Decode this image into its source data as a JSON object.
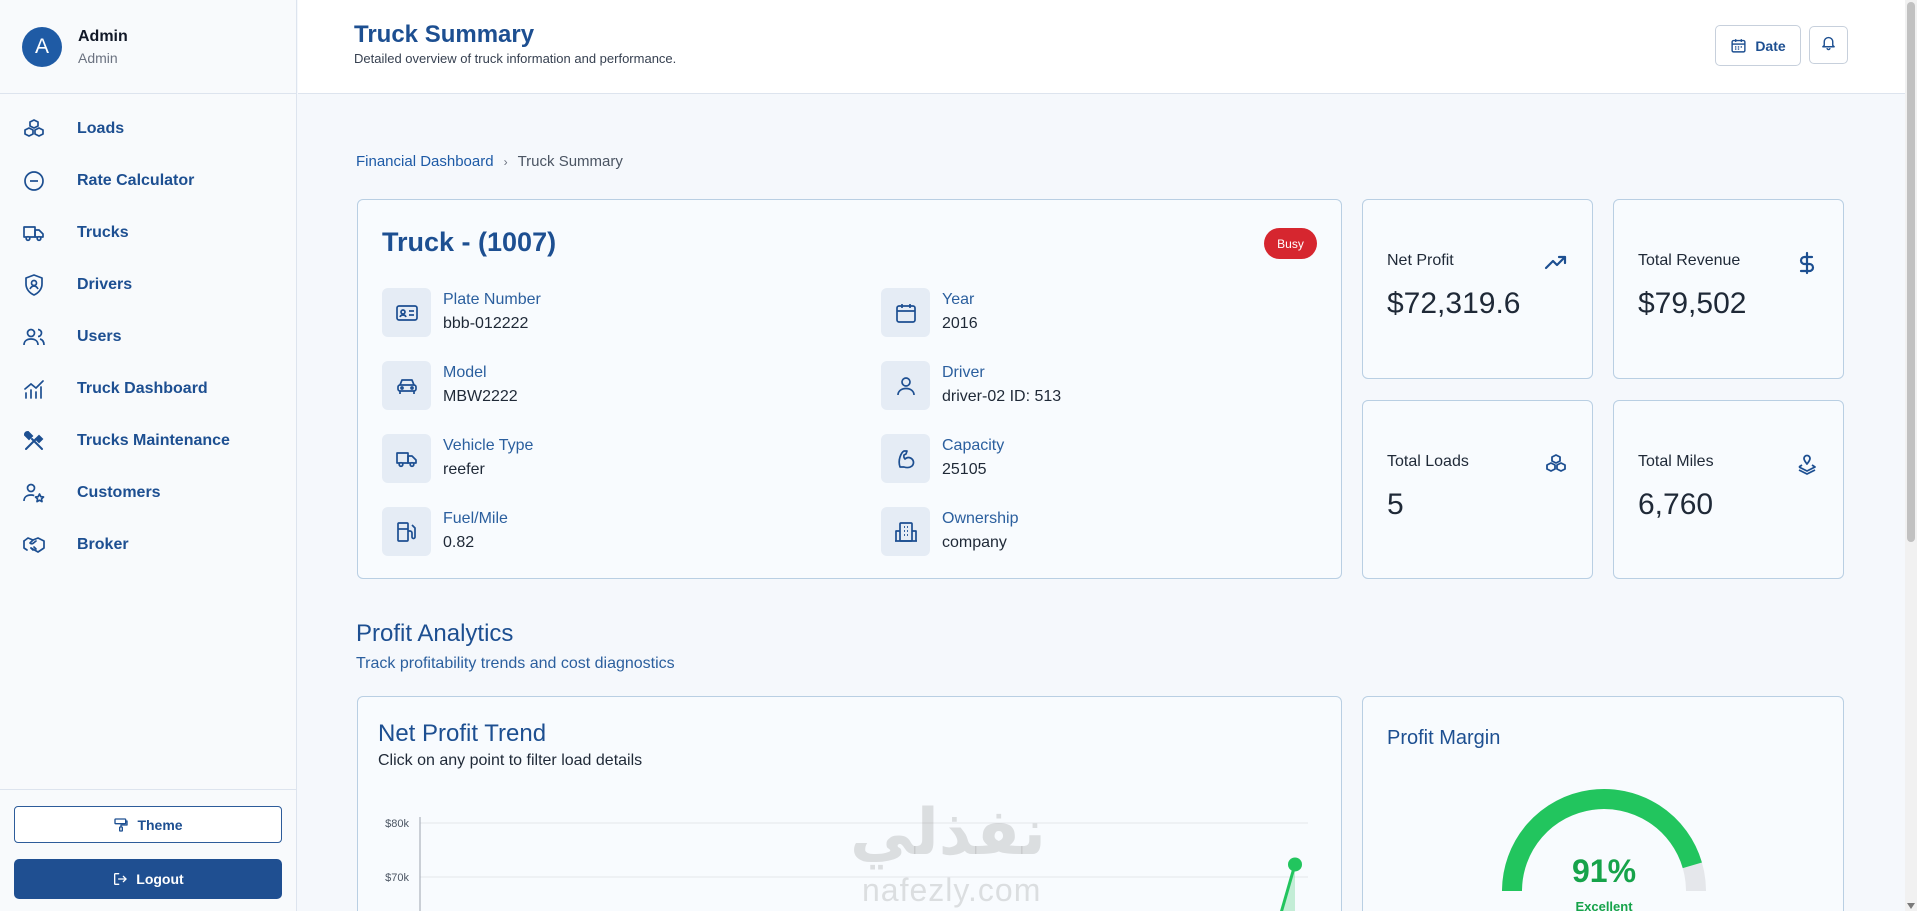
{
  "profile": {
    "initial": "A",
    "name": "Admin",
    "role": "Admin"
  },
  "sidebar": {
    "items": [
      {
        "label": "Loads",
        "icon": "boxes-icon"
      },
      {
        "label": "Rate Calculator",
        "icon": "minus-circle-icon"
      },
      {
        "label": "Trucks",
        "icon": "truck-icon"
      },
      {
        "label": "Drivers",
        "icon": "shield-user-icon"
      },
      {
        "label": "Users",
        "icon": "users-icon"
      },
      {
        "label": "Truck Dashboard",
        "icon": "chart-line-icon"
      },
      {
        "label": "Trucks Maintenance",
        "icon": "wrench-hammer-icon"
      },
      {
        "label": "Customers",
        "icon": "user-star-icon"
      },
      {
        "label": "Broker",
        "icon": "handshake-icon"
      }
    ],
    "theme_label": "Theme",
    "logout_label": "Logout"
  },
  "header": {
    "title": "Truck Summary",
    "subtitle": "Detailed overview of truck information and performance.",
    "date_label": "Date"
  },
  "breadcrumb": {
    "parent": "Financial Dashboard",
    "separator": "›",
    "current": "Truck Summary"
  },
  "truck": {
    "title": "Truck - (1007)",
    "status": "Busy",
    "fields": [
      {
        "label": "Plate Number",
        "value": "bbb-012222",
        "icon": "id-card-icon"
      },
      {
        "label": "Year",
        "value": "2016",
        "icon": "calendar-icon"
      },
      {
        "label": "Model",
        "value": "MBW2222",
        "icon": "car-icon"
      },
      {
        "label": "Driver",
        "value": "driver-02 ID: 513",
        "icon": "user-icon"
      },
      {
        "label": "Vehicle Type",
        "value": "reefer",
        "icon": "truck-icon"
      },
      {
        "label": "Capacity",
        "value": "25105",
        "icon": "bicep-icon"
      },
      {
        "label": "Fuel/Mile",
        "value": "0.82",
        "icon": "fuel-pump-icon"
      },
      {
        "label": "Ownership",
        "value": "company",
        "icon": "building-icon"
      }
    ]
  },
  "stats": {
    "net_profit": {
      "label": "Net Profit",
      "value": "$72,319.6",
      "icon": "trending-up-icon"
    },
    "total_revenue": {
      "label": "Total Revenue",
      "value": "$79,502",
      "icon": "dollar-icon"
    },
    "total_loads": {
      "label": "Total Loads",
      "value": "5",
      "icon": "boxes-icon"
    },
    "total_miles": {
      "label": "Total Miles",
      "value": "6,760",
      "icon": "route-pin-icon"
    }
  },
  "analytics": {
    "title": "Profit Analytics",
    "subtitle": "Track profitability trends and cost diagnostics",
    "trend_title": "Net Profit Trend",
    "trend_subtitle": "Click on any point to filter load details",
    "margin_title": "Profit Margin",
    "margin_value": "91%",
    "margin_fraction": 0.91,
    "margin_rating": "Excellent"
  },
  "chart_data": {
    "type": "line",
    "y_ticks": [
      "$80k",
      "$70k"
    ],
    "ylim": [
      60000,
      80000
    ],
    "visible_points": [
      {
        "y": 72319.6
      }
    ],
    "grid": true
  },
  "watermark": {
    "text": "نفذلي",
    "sub": "nafezly.com"
  },
  "colors": {
    "primary": "#1d4f91",
    "accent": "#1f5ba5",
    "danger": "#d6262f",
    "success": "#22c55e",
    "background": "#f5f8fc"
  }
}
